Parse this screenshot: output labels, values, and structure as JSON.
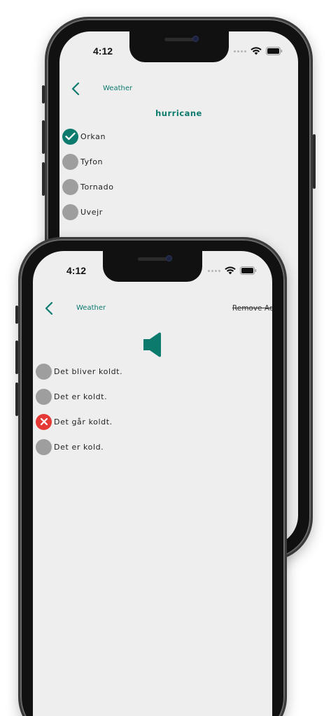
{
  "colors": {
    "accent": "#0d7a6e",
    "wrong": "#e53935",
    "neutral": "#9e9e9e",
    "screen_bg": "#eeeeee"
  },
  "back_screen": {
    "status": {
      "time": "4:12"
    },
    "nav": {
      "back_icon": "chevron-left-icon",
      "title": "Weather"
    },
    "word": "hurricane",
    "options": [
      {
        "label": "Orkan",
        "state": "correct",
        "icon": "check-icon"
      },
      {
        "label": "Tyfon",
        "state": "unselected"
      },
      {
        "label": "Tornado",
        "state": "unselected"
      },
      {
        "label": "Uvejr",
        "state": "unselected"
      }
    ]
  },
  "front_screen": {
    "status": {
      "time": "4:12"
    },
    "nav": {
      "back_icon": "chevron-left-icon",
      "title": "Weather",
      "remove_ads": "Remove Ads"
    },
    "sound_icon": "speaker-icon",
    "options": [
      {
        "label": "Det bliver koldt.",
        "state": "unselected"
      },
      {
        "label": "Det er koldt.",
        "state": "unselected"
      },
      {
        "label": "Det går koldt.",
        "state": "wrong",
        "icon": "close-icon"
      },
      {
        "label": "Det er kold.",
        "state": "unselected"
      }
    ]
  }
}
